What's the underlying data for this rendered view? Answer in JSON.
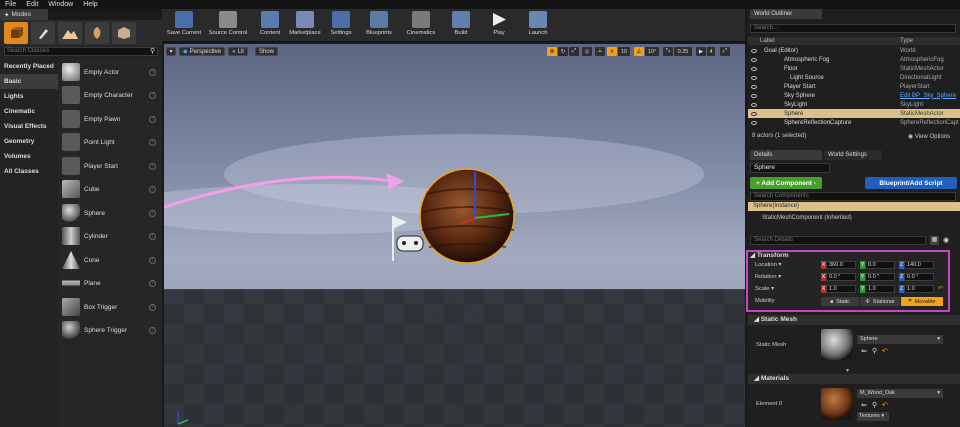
{
  "menu": [
    "File",
    "Edit",
    "Window",
    "Help"
  ],
  "modes_tab": "Modes",
  "mode_icons": [
    "place-icon",
    "paint-icon",
    "landscape-icon",
    "foliage-icon",
    "geometry-icon"
  ],
  "search_classes_placeholder": "Search Classes",
  "categories": [
    "Recently Placed",
    "Basic",
    "Lights",
    "Cinematic",
    "Visual Effects",
    "Geometry",
    "Volumes",
    "All Classes"
  ],
  "active_category": "Basic",
  "place_items": [
    "Empty Actor",
    "Empty Character",
    "Empty Pawn",
    "Point Light",
    "Player Start",
    "Cube",
    "Sphere",
    "Cylinder",
    "Cone",
    "Plane",
    "Box Trigger",
    "Sphere Trigger"
  ],
  "toolbar": [
    "Save Current",
    "Source Control",
    "Content",
    "Marketplace",
    "Settings",
    "Blueprints",
    "Cinematics",
    "Build",
    "Play",
    "Launch"
  ],
  "viewport": {
    "perspective": "Perspective",
    "lit": "Lit",
    "show": "Show",
    "snap_grid": "10",
    "snap_rot": "10°",
    "snap_scale": "0.25",
    "camera_speed": "4"
  },
  "outliner": {
    "tab": "World Outliner",
    "search_placeholder": "Search...",
    "col_label": "Label",
    "col_type": "Type",
    "rows": [
      {
        "label": "Goal (Editor)",
        "type": "World"
      },
      {
        "label": "Atmospheric Fog",
        "type": "AtmosphericFog"
      },
      {
        "label": "Floor",
        "type": "StaticMeshActor"
      },
      {
        "label": "Light Source",
        "type": "DirectionalLight"
      },
      {
        "label": "Player Start",
        "type": "PlayerStart"
      },
      {
        "label": "Sky Sphere",
        "type": "Edit BP_Sky_Sphere"
      },
      {
        "label": "SkyLight",
        "type": "SkyLight"
      },
      {
        "label": "Sphere",
        "type": "StaticMeshActor"
      },
      {
        "label": "SphereReflectionCapture",
        "type": "SphereReflectionCapt"
      }
    ],
    "footer": "8 actors (1 selected)",
    "view_options": "View Options"
  },
  "details": {
    "tab": "Details",
    "tab2": "World Settings",
    "name": "Sphere",
    "add_component": "+ Add Component -",
    "blueprint": "Blueprint/Add Script",
    "search_components": "Search Components",
    "instance": "Sphere(Instance)",
    "component": "StaticMeshComponent (Inherited)",
    "search_details": "Search Details",
    "transform": "Transform",
    "location_label": "Location",
    "location": [
      "360.0",
      "0.0",
      "140.0"
    ],
    "rotation_label": "Rotation",
    "rotation": [
      "0.0 °",
      "0.0 °",
      "0.0 °"
    ],
    "scale_label": "Scale",
    "scale": [
      "1.0",
      "1.0",
      "1.0"
    ],
    "mobility_label": "Mobility",
    "mobility": [
      "Static",
      "Stationar",
      "Movable"
    ],
    "static_mesh_section": "Static Mesh",
    "static_mesh_label": "Static Mesh",
    "static_mesh_value": "Sphere",
    "materials_section": "Materials",
    "element_label": "Element 0",
    "material_value": "M_Wood_Oak",
    "textures": "Textures"
  },
  "colors": {
    "accent": "#f0a21a",
    "highlight": "#c844c8",
    "selection": "#e0c08a",
    "arrow": "#f2a0ea"
  }
}
